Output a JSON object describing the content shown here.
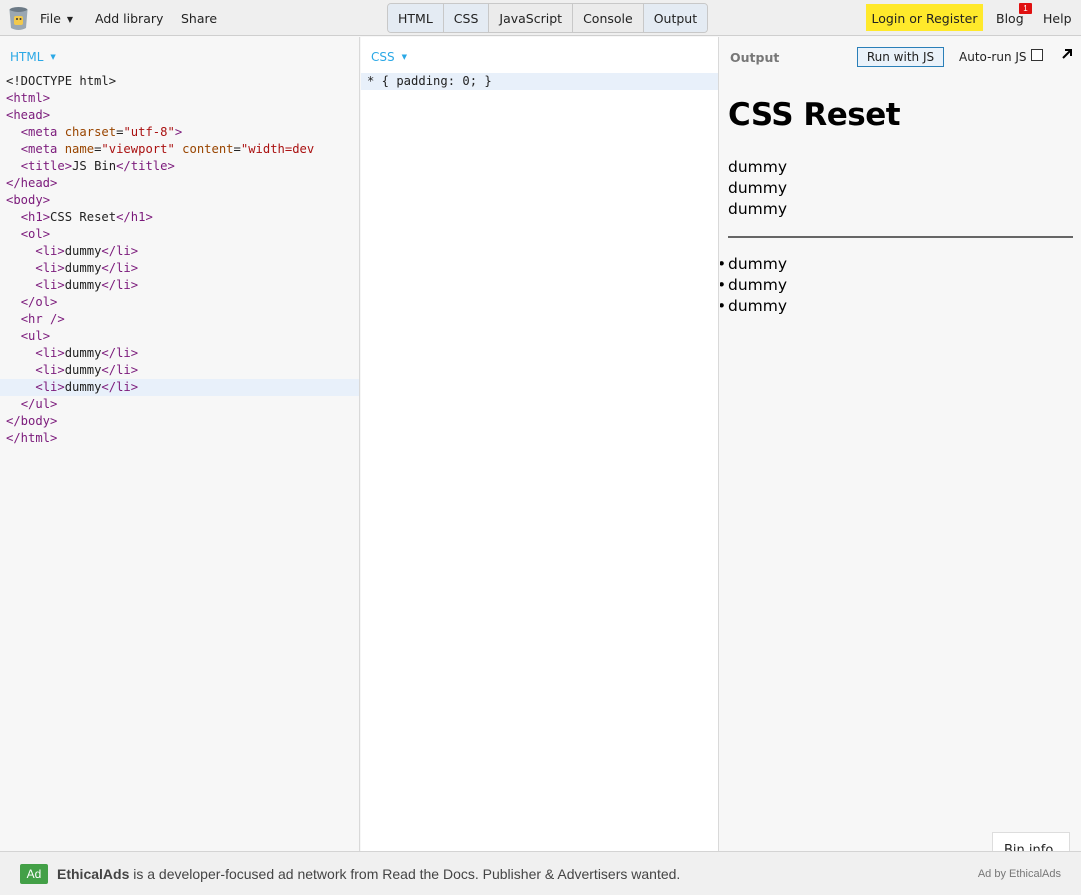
{
  "topbar": {
    "menus": [
      "File",
      "Add library",
      "Share"
    ],
    "tabs": [
      "HTML",
      "CSS",
      "JavaScript",
      "Console",
      "Output"
    ],
    "login_label": "Login or Register",
    "blog_label": "Blog",
    "blog_badge": "1",
    "help_label": "Help",
    "accent": "#ffe92b"
  },
  "html_panel": {
    "label": "HTML",
    "lines": [
      "<!DOCTYPE html>",
      "<html>",
      "<head>",
      "  <meta charset=\"utf-8\">",
      "  <meta name=\"viewport\" content=\"width=dev",
      "  <title>JS Bin</title>",
      "</head>",
      "<body>",
      "  <h1>CSS Reset</h1>",
      "  <ol>",
      "    <li>dummy</li>",
      "    <li>dummy</li>",
      "    <li>dummy</li>",
      "  </ol>",
      "  <hr />",
      "  <ul>",
      "    <li>dummy</li>",
      "    <li>dummy</li>",
      "    <li>dummy</li>",
      "  </ul>",
      "</body>",
      "</html>"
    ]
  },
  "css_panel": {
    "label": "CSS",
    "code": "* { padding: 0; }"
  },
  "output_panel": {
    "label": "Output",
    "run_label": "Run with JS",
    "autorun_label": "Auto-run JS",
    "heading": "CSS Reset",
    "ol_items": [
      "dummy",
      "dummy",
      "dummy"
    ],
    "ul_items": [
      "dummy",
      "dummy",
      "dummy"
    ],
    "bin_info": "Bin info"
  },
  "footer": {
    "ad_badge": "Ad",
    "ad_brand": "EthicalAds",
    "ad_text": " is a developer-focused ad network from Read the Docs. Publisher & Advertisers wanted.",
    "ad_by": "Ad by EthicalAds"
  }
}
